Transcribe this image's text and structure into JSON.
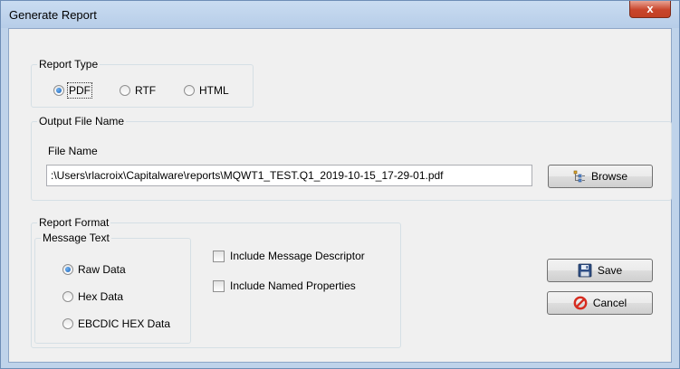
{
  "window": {
    "title": "Generate Report",
    "close_glyph": "x"
  },
  "report_type": {
    "legend": "Report Type",
    "options": [
      {
        "label": "PDF",
        "selected": true
      },
      {
        "label": "RTF",
        "selected": false
      },
      {
        "label": "HTML",
        "selected": false
      }
    ]
  },
  "output": {
    "legend": "Output File Name",
    "file_name_label": "File Name",
    "file_name_value": ":\\Users\\rlacroix\\Capitalware\\reports\\MQWT1_TEST.Q1_2019-10-15_17-29-01.pdf",
    "browse_label": "Browse"
  },
  "report_format": {
    "legend": "Report Format",
    "message_text": {
      "legend": "Message Text",
      "options": [
        {
          "label": "Raw Data",
          "selected": true
        },
        {
          "label": "Hex Data",
          "selected": false
        },
        {
          "label": "EBCDIC HEX Data",
          "selected": false
        }
      ]
    },
    "include_descriptor_label": "Include Message Descriptor",
    "include_descriptor_checked": false,
    "include_properties_label": "Include Named Properties",
    "include_properties_checked": false
  },
  "buttons": {
    "save_label": "Save",
    "cancel_label": "Cancel"
  },
  "icons": {
    "browse": "folder-tree-icon",
    "save": "floppy-disk-icon",
    "cancel": "prohibited-icon",
    "close": "close-icon"
  },
  "colors": {
    "titlebar": "#c3d6ee",
    "close_button": "#c8452b",
    "dialog_bg": "#f0f0f0",
    "radio_selected": "#1d63b7"
  }
}
